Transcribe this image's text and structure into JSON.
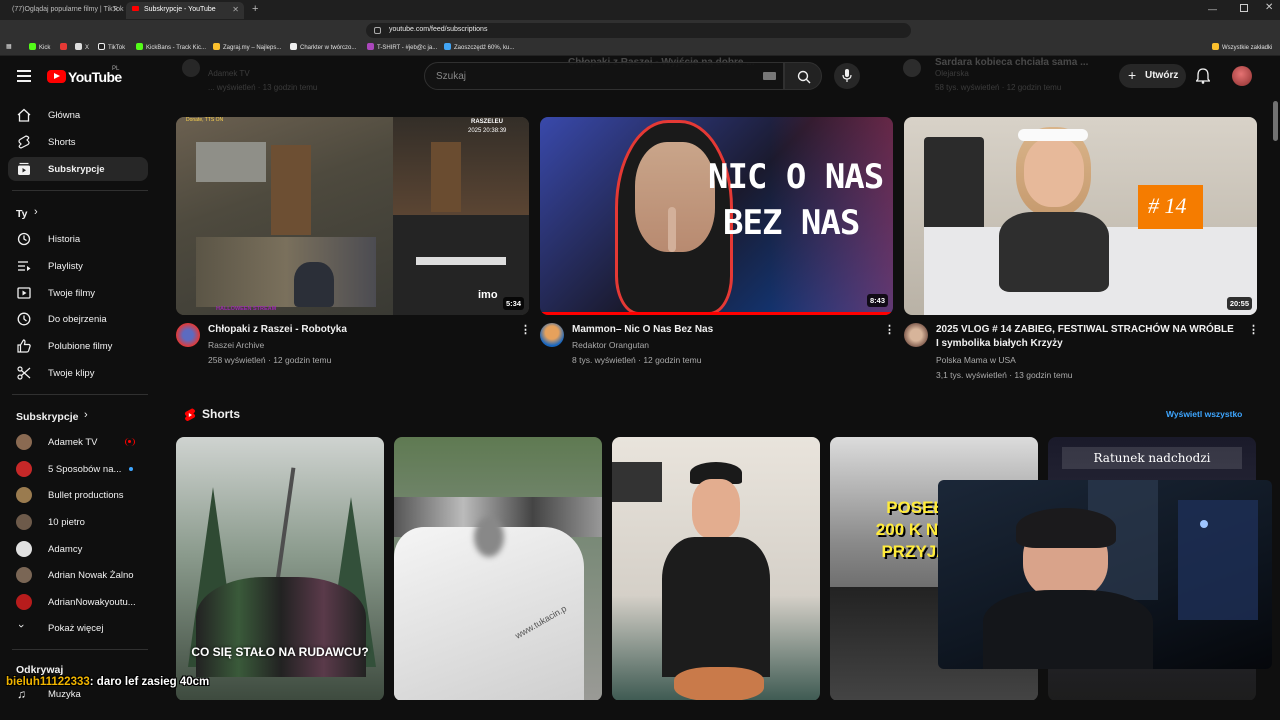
{
  "browser": {
    "tabs": [
      {
        "title": "(77)Oglądaj popularne filmy | TikTok"
      },
      {
        "title": "Subskrypcje - YouTube"
      }
    ],
    "url": "youtube.com/feed/subscriptions",
    "bookmarks": [
      "Kick",
      "X",
      "TikTok",
      "KickBans - Track Kic...",
      "Zagraj.my – Najleps...",
      "Charkter w twórczo...",
      "T-SHIRT - #jeb@c ja...",
      "Zaoszczędź 60%, ku..."
    ],
    "bookmarks_folder": "Wszystkie zakładki"
  },
  "youtube": {
    "logo": "YouTube",
    "logo_country": "PL",
    "search_placeholder": "Szukaj",
    "create_label": "Utwórz"
  },
  "sidebar": {
    "main": [
      {
        "label": "Główna",
        "icon": "home-icon"
      },
      {
        "label": "Shorts",
        "icon": "shorts-icon"
      },
      {
        "label": "Subskrypcje",
        "icon": "subscriptions-icon",
        "selected": true
      }
    ],
    "you_header": "Ty",
    "you_items": [
      {
        "label": "Historia",
        "icon": "history-icon"
      },
      {
        "label": "Playlisty",
        "icon": "playlist-icon"
      },
      {
        "label": "Twoje filmy",
        "icon": "your-videos-icon"
      },
      {
        "label": "Do obejrzenia",
        "icon": "watch-later-icon"
      },
      {
        "label": "Polubione filmy",
        "icon": "liked-icon"
      },
      {
        "label": "Twoje klipy",
        "icon": "clips-icon"
      }
    ],
    "subs_header": "Subskrypcje",
    "subscriptions": [
      {
        "label": "Adamek TV",
        "badge": "live",
        "color": "#8a6a52"
      },
      {
        "label": "5 Sposobów na...",
        "badge": "dot",
        "color": "#c62828"
      },
      {
        "label": "Bullet productions",
        "badge": "",
        "color": "#9a7b4f"
      },
      {
        "label": "10 pietro",
        "badge": "",
        "color": "#6d5a4a"
      },
      {
        "label": "Adamcy",
        "badge": "",
        "color": "#e0e0e0"
      },
      {
        "label": "Adrian Nowak Żalno",
        "badge": "",
        "color": "#7a6655"
      },
      {
        "label": "AdrianNowakyoutu...",
        "badge": "",
        "color": "#b71c1c"
      }
    ],
    "show_more": "Pokaż więcej",
    "explore_header": "Odkrywaj",
    "explore_items": [
      "Muzyka"
    ]
  },
  "videos": [
    {
      "title": "Chłopaki z Raszei - Robotyka",
      "channel": "Raszei Archive",
      "meta": "258 wyświetleń · 12 godzin temu",
      "duration": "5:34",
      "overlay_site": "RASZEI.EU",
      "overlay_date": "2025 20:38:39",
      "overlay_top": "Donate, TTS ON",
      "overlay_bottom": "HALLOWEEN STREAM",
      "overlay_logo": "imo"
    },
    {
      "title": "Mammon– Nic O Nas Bez Nas",
      "channel": "Redaktor Orangutan",
      "meta": "8 tys. wyświetleń · 12 godzin temu",
      "duration": "8:43",
      "overlay_line1": "NIC O NAS",
      "overlay_line2": "BEZ NAS"
    },
    {
      "title": "2025 VLOG # 14 ZABIEG, FESTIWAL STRACHÓW NA WRÓBLE I symbolika białych Krzyży",
      "channel": "Polska Mama w USA",
      "meta": "3,1 tys. wyświetleń · 13 godzin temu",
      "duration": "20:55",
      "overlay_badge": "# 14"
    }
  ],
  "faded_row": {
    "left_channel": "Adamek TV",
    "left_meta": "... wyświetleń · 13 godzin temu",
    "mid_title": "Chłopaki z Raszei - Wyjście na dobre ...",
    "right_title": "Sardara kobieca chciała sama ...",
    "right_channel": "Olejarska",
    "right_meta": "58 tys. wyświetleń · 12 godzin temu"
  },
  "shorts": {
    "header": "Shorts",
    "view_all": "Wyświetl wszystko",
    "items": [
      {
        "caption": "CO SIĘ STAŁO NA RUDAWCU?"
      },
      {
        "caption": "www.tukacin.p"
      },
      {
        "caption": ""
      },
      {
        "caption": "POSEŁ 200 K NIE PRZYJĄ"
      },
      {
        "caption": "Ratunek nadchodzi"
      }
    ]
  },
  "chat_overlay": {
    "user": "bieluh11122333",
    "message": ": daro lef zasieg 40cm"
  },
  "colors": {
    "accent_red": "#ff0000",
    "link_blue": "#3ea6ff",
    "bg": "#0f0f0f"
  }
}
